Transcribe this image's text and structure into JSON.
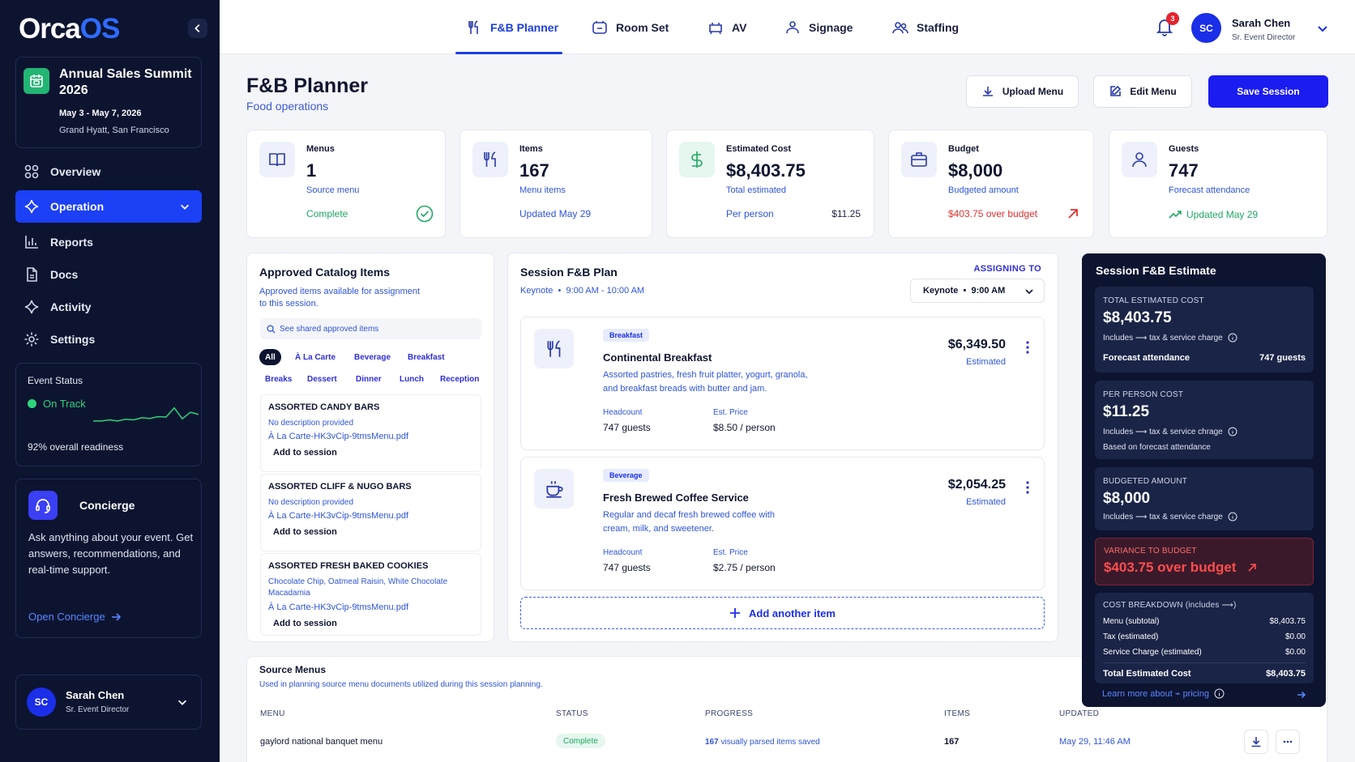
{
  "app": {
    "logo_part1": "Orca",
    "logo_part2": "OS"
  },
  "event": {
    "name": "Annual Sales Summit 2026",
    "dates": "May 3 - May 7, 2026",
    "venue": "Grand Hyatt, San Francisco",
    "icon": "calendar-icon"
  },
  "nav": {
    "items": [
      {
        "label": "Overview",
        "icon": "grid-icon"
      },
      {
        "label": "Operation",
        "icon": "sparkle-icon",
        "active": true
      },
      {
        "label": "Reports",
        "icon": "bar-chart-icon"
      },
      {
        "label": "Docs",
        "icon": "document-icon"
      },
      {
        "label": "Activity",
        "icon": "sparkle-icon"
      },
      {
        "label": "Settings",
        "icon": "gear-icon"
      }
    ]
  },
  "status": {
    "title": "Event Status",
    "state": "On Track",
    "readiness": "92% overall readiness",
    "trend": [
      0.3,
      0.3,
      0.35,
      0.3,
      0.38,
      0.35,
      0.45,
      0.42,
      0.5,
      0.48,
      0.9,
      0.4,
      0.7,
      0.6
    ]
  },
  "concierge": {
    "title": "Concierge",
    "text": "Ask anything about your event. Get answers, recommendations, and real-time support.",
    "link": "Open Concierge"
  },
  "user": {
    "name": "Sarah Chen",
    "role": "Sr. Event Director",
    "initials": "SC",
    "notifications": "3"
  },
  "tabs": [
    {
      "label": "F&B Planner",
      "active": true
    },
    {
      "label": "Room Set"
    },
    {
      "label": "AV"
    },
    {
      "label": "Signage"
    },
    {
      "label": "Staffing"
    }
  ],
  "page": {
    "title": "F&B Planner",
    "subtitle": "Food operations",
    "upload_label": "Upload Menu",
    "edit_label": "Edit Menu",
    "save_label": "Save Session"
  },
  "kpis": {
    "menus": {
      "label": "Menus",
      "value": "1",
      "sub": "Source menu",
      "foot": "Complete"
    },
    "items": {
      "label": "Items",
      "value": "167",
      "sub": "Menu items",
      "foot": "Updated May 29"
    },
    "cost": {
      "label": "Estimated Cost",
      "value": "$8,403.75",
      "sub": "Total estimated",
      "foot": "Per person",
      "right": "$11.25"
    },
    "budget": {
      "label": "Budget",
      "value": "$8,000",
      "sub": "Budgeted amount",
      "foot": "$403.75 over budget"
    },
    "guests": {
      "label": "Guests",
      "value": "747",
      "sub": "Forecast attendance",
      "foot": "Updated May 29"
    }
  },
  "catalog": {
    "title": "Approved Catalog Items",
    "desc": "Approved items available for assignment to this session.",
    "search_placeholder": "See shared approved items",
    "chips": [
      "All",
      "À La Carte",
      "Beverage",
      "Breakfast",
      "Breaks",
      "Dessert",
      "Dinner",
      "Lunch",
      "Reception"
    ],
    "items": [
      {
        "name": "ASSORTED CANDY BARS",
        "desc": "No description provided",
        "file": "À La Carte-HK3vCip-9tmsMenu.pdf",
        "action": "Add to session"
      },
      {
        "name": "ASSORTED CLIFF & NUGO BARS",
        "desc": "No description provided",
        "file": "À La Carte-HK3vCip-9tmsMenu.pdf",
        "action": "Add to session"
      },
      {
        "name": "ASSORTED FRESH BAKED COOKIES",
        "desc": "Chocolate Chip, Oatmeal Raisin, White Chocolate Macadamia",
        "file": "À La Carte-HK3vCip-9tmsMenu.pdf",
        "action": "Add to session"
      }
    ]
  },
  "plan": {
    "title": "Session F&B Plan",
    "session": "Keynote",
    "time": "9:00 AM - 10:00 AM",
    "assign_label": "ASSIGNING TO",
    "assign_session": "Keynote",
    "assign_time": "9:00 AM",
    "items": [
      {
        "tag": "Breakfast",
        "name": "Continental Breakfast",
        "desc": "Assorted pastries, fresh fruit platter, yogurt, granola, and breakfast breads with butter and jam.",
        "headcount_label": "Headcount",
        "headcount": "747 guests",
        "price_label": "Est. Price",
        "price": "$8.50 / person",
        "total": "$6,349.50",
        "total_label": "Estimated",
        "icon": "utensils-icon"
      },
      {
        "tag": "Beverage",
        "name": "Fresh Brewed Coffee Service",
        "desc": "Regular and decaf fresh brewed coffee with cream, milk, and sweetener.",
        "headcount_label": "Headcount",
        "headcount": "747 guests",
        "price_label": "Est. Price",
        "price": "$2.75 / person",
        "total": "$2,054.25",
        "total_label": "Estimated",
        "icon": "coffee-icon"
      }
    ],
    "add_label": "Add another item"
  },
  "source": {
    "title": "Source Menus",
    "desc": "Used in planning source menu documents utilized during this session planning.",
    "headers": [
      "MENU",
      "STATUS",
      "PROGRESS",
      "ITEMS",
      "UPDATED"
    ],
    "row": {
      "menu": "gaylord national banquet menu",
      "status": "Complete",
      "progress_count": "167",
      "progress_text": "visually parsed items saved",
      "items": "167",
      "updated": "May 29, 11:46 AM"
    }
  },
  "estimate": {
    "title": "Session F&B Estimate",
    "total_label": "TOTAL ESTIMATED COST",
    "total_value": "$8,403.75",
    "includes": "Includes ⟶ tax & service charge",
    "forecast_label": "Forecast attendance",
    "forecast_value": "747 guests",
    "pp_label": "PER PERSON COST",
    "pp_value": "$11.25",
    "pp_includes": "Includes ⟶ tax & service chrage",
    "pp_note": "Based on forecast attendance",
    "budget_label": "BUDGETED AMOUNT",
    "budget_value": "$8,000",
    "budget_includes": "Includes ⟶ tax & service charge",
    "variance_label": "VARIANCE TO BUDGET",
    "variance_value": "$403.75 over budget",
    "breakdown_label": "COST BREAKDOWN (includes ⟶)",
    "breakdown": [
      {
        "label": "Menu (subtotal)",
        "value": "$8,403.75"
      },
      {
        "label": "Tax (estimated)",
        "value": "$0.00"
      },
      {
        "label": "Service Charge (estimated)",
        "value": "$0.00"
      }
    ],
    "total_row_label": "Total Estimated Cost",
    "total_row_value": "$8,403.75",
    "footer": "Learn more about ⌁ pricing"
  },
  "colors": {
    "accent": "#1b1cf0",
    "sidebar": "#0c1430",
    "success": "#1fa862",
    "danger": "#e03131"
  }
}
